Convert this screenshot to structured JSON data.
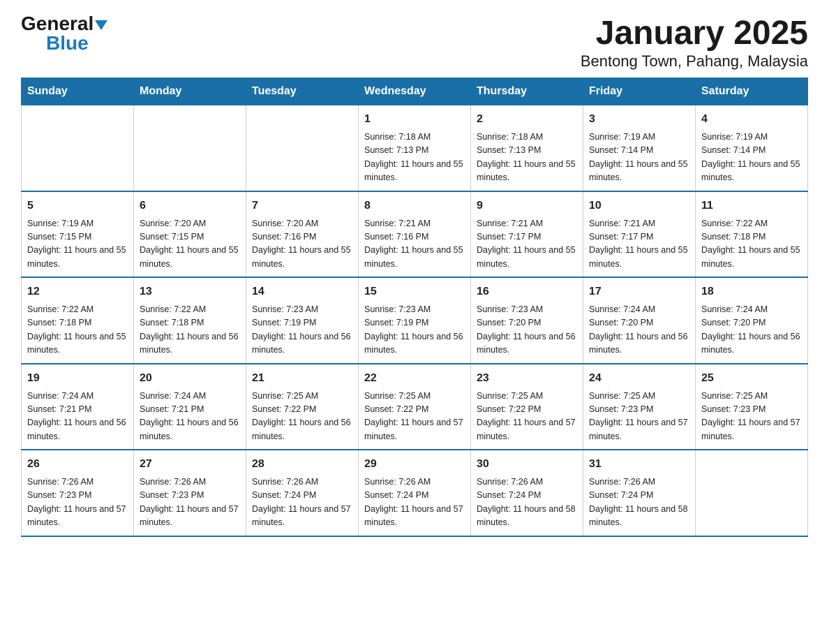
{
  "logo": {
    "general": "General",
    "triangle": "▶",
    "blue": "Blue"
  },
  "title": "January 2025",
  "subtitle": "Bentong Town, Pahang, Malaysia",
  "days_of_week": [
    "Sunday",
    "Monday",
    "Tuesday",
    "Wednesday",
    "Thursday",
    "Friday",
    "Saturday"
  ],
  "weeks": [
    [
      {
        "day": "",
        "info": ""
      },
      {
        "day": "",
        "info": ""
      },
      {
        "day": "",
        "info": ""
      },
      {
        "day": "1",
        "info": "Sunrise: 7:18 AM\nSunset: 7:13 PM\nDaylight: 11 hours and 55 minutes."
      },
      {
        "day": "2",
        "info": "Sunrise: 7:18 AM\nSunset: 7:13 PM\nDaylight: 11 hours and 55 minutes."
      },
      {
        "day": "3",
        "info": "Sunrise: 7:19 AM\nSunset: 7:14 PM\nDaylight: 11 hours and 55 minutes."
      },
      {
        "day": "4",
        "info": "Sunrise: 7:19 AM\nSunset: 7:14 PM\nDaylight: 11 hours and 55 minutes."
      }
    ],
    [
      {
        "day": "5",
        "info": "Sunrise: 7:19 AM\nSunset: 7:15 PM\nDaylight: 11 hours and 55 minutes."
      },
      {
        "day": "6",
        "info": "Sunrise: 7:20 AM\nSunset: 7:15 PM\nDaylight: 11 hours and 55 minutes."
      },
      {
        "day": "7",
        "info": "Sunrise: 7:20 AM\nSunset: 7:16 PM\nDaylight: 11 hours and 55 minutes."
      },
      {
        "day": "8",
        "info": "Sunrise: 7:21 AM\nSunset: 7:16 PM\nDaylight: 11 hours and 55 minutes."
      },
      {
        "day": "9",
        "info": "Sunrise: 7:21 AM\nSunset: 7:17 PM\nDaylight: 11 hours and 55 minutes."
      },
      {
        "day": "10",
        "info": "Sunrise: 7:21 AM\nSunset: 7:17 PM\nDaylight: 11 hours and 55 minutes."
      },
      {
        "day": "11",
        "info": "Sunrise: 7:22 AM\nSunset: 7:18 PM\nDaylight: 11 hours and 55 minutes."
      }
    ],
    [
      {
        "day": "12",
        "info": "Sunrise: 7:22 AM\nSunset: 7:18 PM\nDaylight: 11 hours and 55 minutes."
      },
      {
        "day": "13",
        "info": "Sunrise: 7:22 AM\nSunset: 7:18 PM\nDaylight: 11 hours and 56 minutes."
      },
      {
        "day": "14",
        "info": "Sunrise: 7:23 AM\nSunset: 7:19 PM\nDaylight: 11 hours and 56 minutes."
      },
      {
        "day": "15",
        "info": "Sunrise: 7:23 AM\nSunset: 7:19 PM\nDaylight: 11 hours and 56 minutes."
      },
      {
        "day": "16",
        "info": "Sunrise: 7:23 AM\nSunset: 7:20 PM\nDaylight: 11 hours and 56 minutes."
      },
      {
        "day": "17",
        "info": "Sunrise: 7:24 AM\nSunset: 7:20 PM\nDaylight: 11 hours and 56 minutes."
      },
      {
        "day": "18",
        "info": "Sunrise: 7:24 AM\nSunset: 7:20 PM\nDaylight: 11 hours and 56 minutes."
      }
    ],
    [
      {
        "day": "19",
        "info": "Sunrise: 7:24 AM\nSunset: 7:21 PM\nDaylight: 11 hours and 56 minutes."
      },
      {
        "day": "20",
        "info": "Sunrise: 7:24 AM\nSunset: 7:21 PM\nDaylight: 11 hours and 56 minutes."
      },
      {
        "day": "21",
        "info": "Sunrise: 7:25 AM\nSunset: 7:22 PM\nDaylight: 11 hours and 56 minutes."
      },
      {
        "day": "22",
        "info": "Sunrise: 7:25 AM\nSunset: 7:22 PM\nDaylight: 11 hours and 57 minutes."
      },
      {
        "day": "23",
        "info": "Sunrise: 7:25 AM\nSunset: 7:22 PM\nDaylight: 11 hours and 57 minutes."
      },
      {
        "day": "24",
        "info": "Sunrise: 7:25 AM\nSunset: 7:23 PM\nDaylight: 11 hours and 57 minutes."
      },
      {
        "day": "25",
        "info": "Sunrise: 7:25 AM\nSunset: 7:23 PM\nDaylight: 11 hours and 57 minutes."
      }
    ],
    [
      {
        "day": "26",
        "info": "Sunrise: 7:26 AM\nSunset: 7:23 PM\nDaylight: 11 hours and 57 minutes."
      },
      {
        "day": "27",
        "info": "Sunrise: 7:26 AM\nSunset: 7:23 PM\nDaylight: 11 hours and 57 minutes."
      },
      {
        "day": "28",
        "info": "Sunrise: 7:26 AM\nSunset: 7:24 PM\nDaylight: 11 hours and 57 minutes."
      },
      {
        "day": "29",
        "info": "Sunrise: 7:26 AM\nSunset: 7:24 PM\nDaylight: 11 hours and 57 minutes."
      },
      {
        "day": "30",
        "info": "Sunrise: 7:26 AM\nSunset: 7:24 PM\nDaylight: 11 hours and 58 minutes."
      },
      {
        "day": "31",
        "info": "Sunrise: 7:26 AM\nSunset: 7:24 PM\nDaylight: 11 hours and 58 minutes."
      },
      {
        "day": "",
        "info": ""
      }
    ]
  ]
}
